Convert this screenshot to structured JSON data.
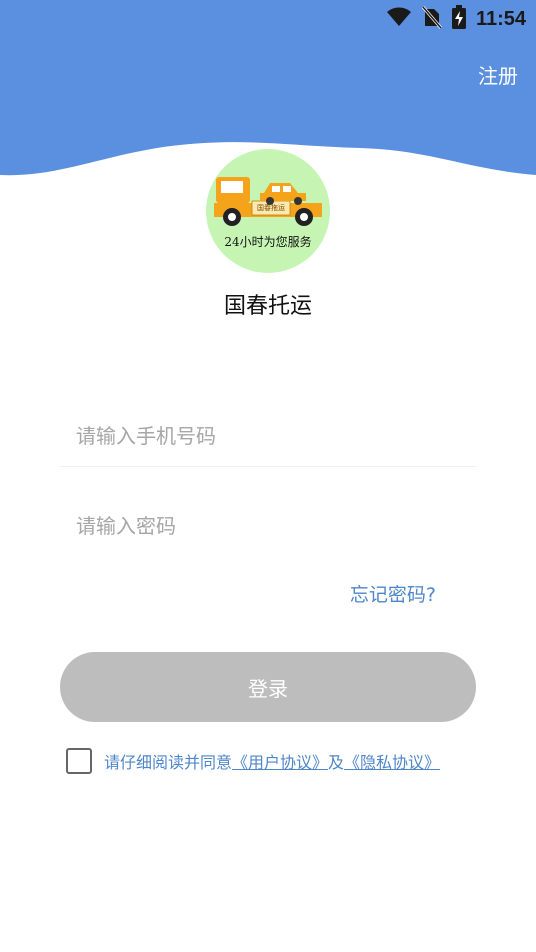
{
  "status_bar": {
    "time": "11:54",
    "icons": [
      "wifi-icon",
      "no-sim-icon",
      "battery-charging-icon"
    ]
  },
  "header": {
    "register_label": "注册",
    "background_color": "#5b8fe0"
  },
  "logo": {
    "sign_text": "国春拖运",
    "slogan": "24小时为您服务",
    "background_color": "#c6f5b3",
    "truck_color": "#f5a31a"
  },
  "app_name": "国春托运",
  "form": {
    "phone_placeholder": "请输入手机号码",
    "password_placeholder": "请输入密码",
    "forgot_label": "忘记密码?",
    "login_label": "登录"
  },
  "agreement": {
    "prefix": "请仔细阅读并同意",
    "user_link": "《用户协议》",
    "joiner": "及",
    "privacy_link": "《隐私协议》",
    "checked": false
  },
  "colors": {
    "accent": "#4f86c9",
    "button_disabled": "#bdbdbd"
  }
}
